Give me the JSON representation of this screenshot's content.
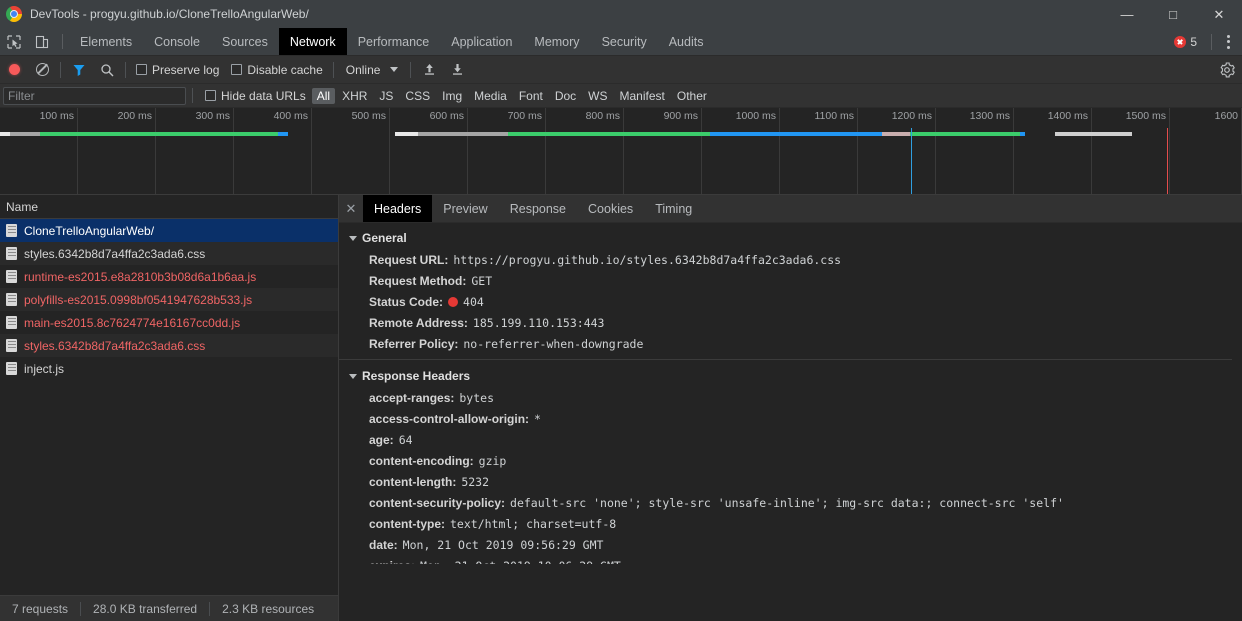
{
  "window": {
    "title": "DevTools - progyu.github.io/CloneTrelloAngularWeb/",
    "minimize": "—",
    "maximize": "□",
    "close": "✕"
  },
  "panel_tabs": [
    {
      "label": "Elements",
      "active": false
    },
    {
      "label": "Console",
      "active": false
    },
    {
      "label": "Sources",
      "active": false
    },
    {
      "label": "Network",
      "active": true
    },
    {
      "label": "Performance",
      "active": false
    },
    {
      "label": "Application",
      "active": false
    },
    {
      "label": "Memory",
      "active": false
    },
    {
      "label": "Security",
      "active": false
    },
    {
      "label": "Audits",
      "active": false
    }
  ],
  "error_badge": {
    "count": "5"
  },
  "network_toolbar": {
    "preserve_log_label": "Preserve log",
    "disable_cache_label": "Disable cache",
    "throttle_value": "Online"
  },
  "filter_bar": {
    "filter_placeholder": "Filter",
    "filter_value": "",
    "hide_data_urls_label": "Hide data URLs",
    "types": [
      {
        "label": "All",
        "active": true
      },
      {
        "label": "XHR",
        "active": false
      },
      {
        "label": "JS",
        "active": false
      },
      {
        "label": "CSS",
        "active": false
      },
      {
        "label": "Img",
        "active": false
      },
      {
        "label": "Media",
        "active": false
      },
      {
        "label": "Font",
        "active": false
      },
      {
        "label": "Doc",
        "active": false
      },
      {
        "label": "WS",
        "active": false
      },
      {
        "label": "Manifest",
        "active": false
      },
      {
        "label": "Other",
        "active": false
      }
    ]
  },
  "overview": {
    "ticks": [
      "100 ms",
      "200 ms",
      "300 ms",
      "400 ms",
      "500 ms",
      "600 ms",
      "700 ms",
      "800 ms",
      "900 ms",
      "1000 ms",
      "1100 ms",
      "1200 ms",
      "1300 ms",
      "1400 ms",
      "1500 ms",
      "1600"
    ],
    "dom_content_loaded_color": "#3399e6",
    "load_event_color": "#e44c4c",
    "waiting_color": "#a5a5a5",
    "downloading_color": "#3bcd6b",
    "blue_segment_color": "#2196f3"
  },
  "request_list": {
    "column_header": "Name",
    "rows": [
      {
        "name": "CloneTrelloAngularWeb/",
        "state": "selected"
      },
      {
        "name": "styles.6342b8d7a4ffa2c3ada6.css",
        "state": "normal"
      },
      {
        "name": "runtime-es2015.e8a2810b3b08d6a1b6aa.js",
        "state": "error"
      },
      {
        "name": "polyfills-es2015.0998bf0541947628b533.js",
        "state": "error"
      },
      {
        "name": "main-es2015.8c7624774e16167cc0dd.js",
        "state": "error"
      },
      {
        "name": "styles.6342b8d7a4ffa2c3ada6.css",
        "state": "error"
      },
      {
        "name": "inject.js",
        "state": "normal"
      }
    ]
  },
  "status_bar": {
    "requests": "7 requests",
    "transferred": "28.0 KB transferred",
    "resources": "2.3 KB resources"
  },
  "detail_tabs": [
    {
      "label": "Headers",
      "active": true
    },
    {
      "label": "Preview",
      "active": false
    },
    {
      "label": "Response",
      "active": false
    },
    {
      "label": "Cookies",
      "active": false
    },
    {
      "label": "Timing",
      "active": false
    }
  ],
  "general": {
    "section_title": "General",
    "rows": [
      {
        "key": "Request URL:",
        "value": "https://progyu.github.io/styles.6342b8d7a4ffa2c3ada6.css",
        "status": false
      },
      {
        "key": "Request Method:",
        "value": "GET",
        "status": false
      },
      {
        "key": "Status Code:",
        "value": "404",
        "status": true
      },
      {
        "key": "Remote Address:",
        "value": "185.199.110.153:443",
        "status": false
      },
      {
        "key": "Referrer Policy:",
        "value": "no-referrer-when-downgrade",
        "status": false
      }
    ]
  },
  "response_headers": {
    "section_title": "Response Headers",
    "rows": [
      {
        "key": "accept-ranges:",
        "value": "bytes"
      },
      {
        "key": "access-control-allow-origin:",
        "value": "*"
      },
      {
        "key": "age:",
        "value": "64"
      },
      {
        "key": "content-encoding:",
        "value": "gzip"
      },
      {
        "key": "content-length:",
        "value": "5232"
      },
      {
        "key": "content-security-policy:",
        "value": "default-src 'none'; style-src 'unsafe-inline'; img-src data:; connect-src 'self'"
      },
      {
        "key": "content-type:",
        "value": "text/html; charset=utf-8"
      },
      {
        "key": "date:",
        "value": "Mon, 21 Oct 2019 09:56:29 GMT"
      }
    ]
  }
}
